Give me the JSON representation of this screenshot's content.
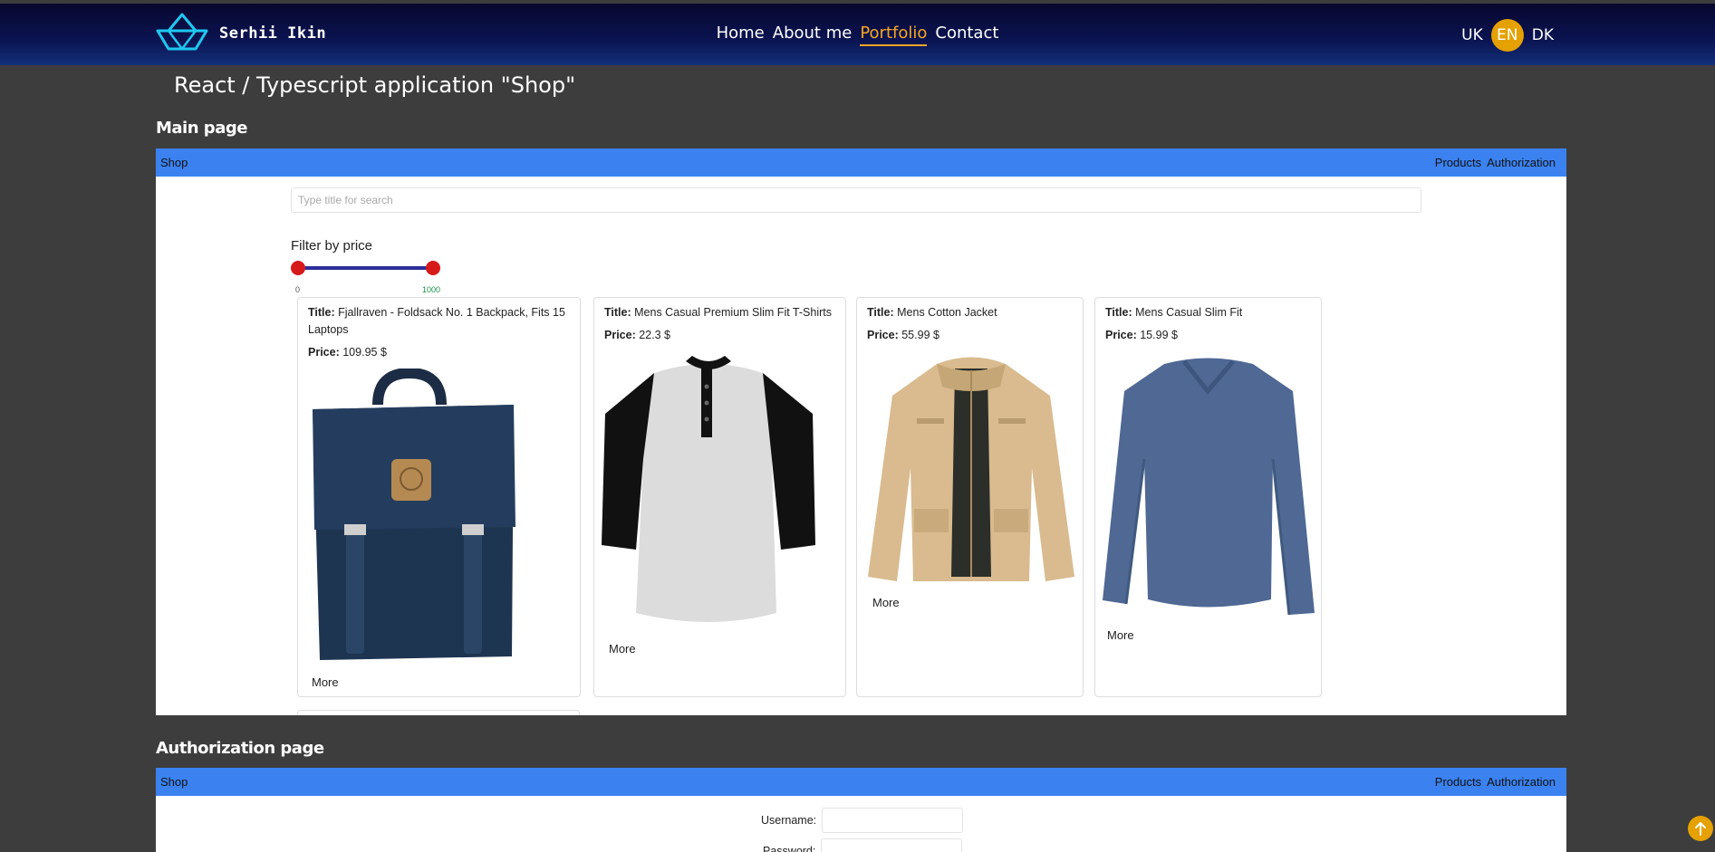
{
  "header": {
    "brand_name": "Serhii Ikin",
    "nav": [
      {
        "label": "Home",
        "active": false
      },
      {
        "label": "About me",
        "active": false
      },
      {
        "label": "Portfolio",
        "active": true
      },
      {
        "label": "Contact",
        "active": false
      }
    ],
    "languages": [
      {
        "code": "UK",
        "active": false
      },
      {
        "code": "EN",
        "active": true
      },
      {
        "code": "DK",
        "active": false
      }
    ]
  },
  "page_title": "React / Typescript application \"Shop\"",
  "sections": {
    "main_page_heading": "Main page",
    "auth_page_heading": "Authorization page"
  },
  "shop_app": {
    "brand": "Shop",
    "nav": [
      "Products",
      "Authorization"
    ],
    "search_placeholder": "Type title for search",
    "filter_label": "Filter by price",
    "price_min": "0",
    "price_max": "1000",
    "title_label": "Title:",
    "price_label": "Price:",
    "more_label": "More",
    "products": [
      {
        "title": "Fjallraven - Foldsack No. 1 Backpack, Fits 15 Laptops",
        "price": "109.95 $",
        "icon": "backpack-image"
      },
      {
        "title": "Mens Casual Premium Slim Fit T-Shirts",
        "price": "22.3 $",
        "icon": "raglan-tshirt-image"
      },
      {
        "title": "Mens Cotton Jacket",
        "price": "55.99 $",
        "icon": "cotton-jacket-image"
      },
      {
        "title": "Mens Casual Slim Fit",
        "price": "15.99 $",
        "icon": "longsleeve-shirt-image"
      }
    ]
  },
  "auth_app": {
    "brand": "Shop",
    "nav": [
      "Products",
      "Authorization"
    ],
    "username_label": "Username:",
    "password_label": "Password:"
  },
  "colors": {
    "accent": "#f6a623",
    "lang_active_bg": "#e5a100",
    "app_bar": "#3b82f0",
    "slider_track": "#2d2d9a",
    "slider_handle": "#d61a1a",
    "page_bg": "#3d3d3d"
  }
}
